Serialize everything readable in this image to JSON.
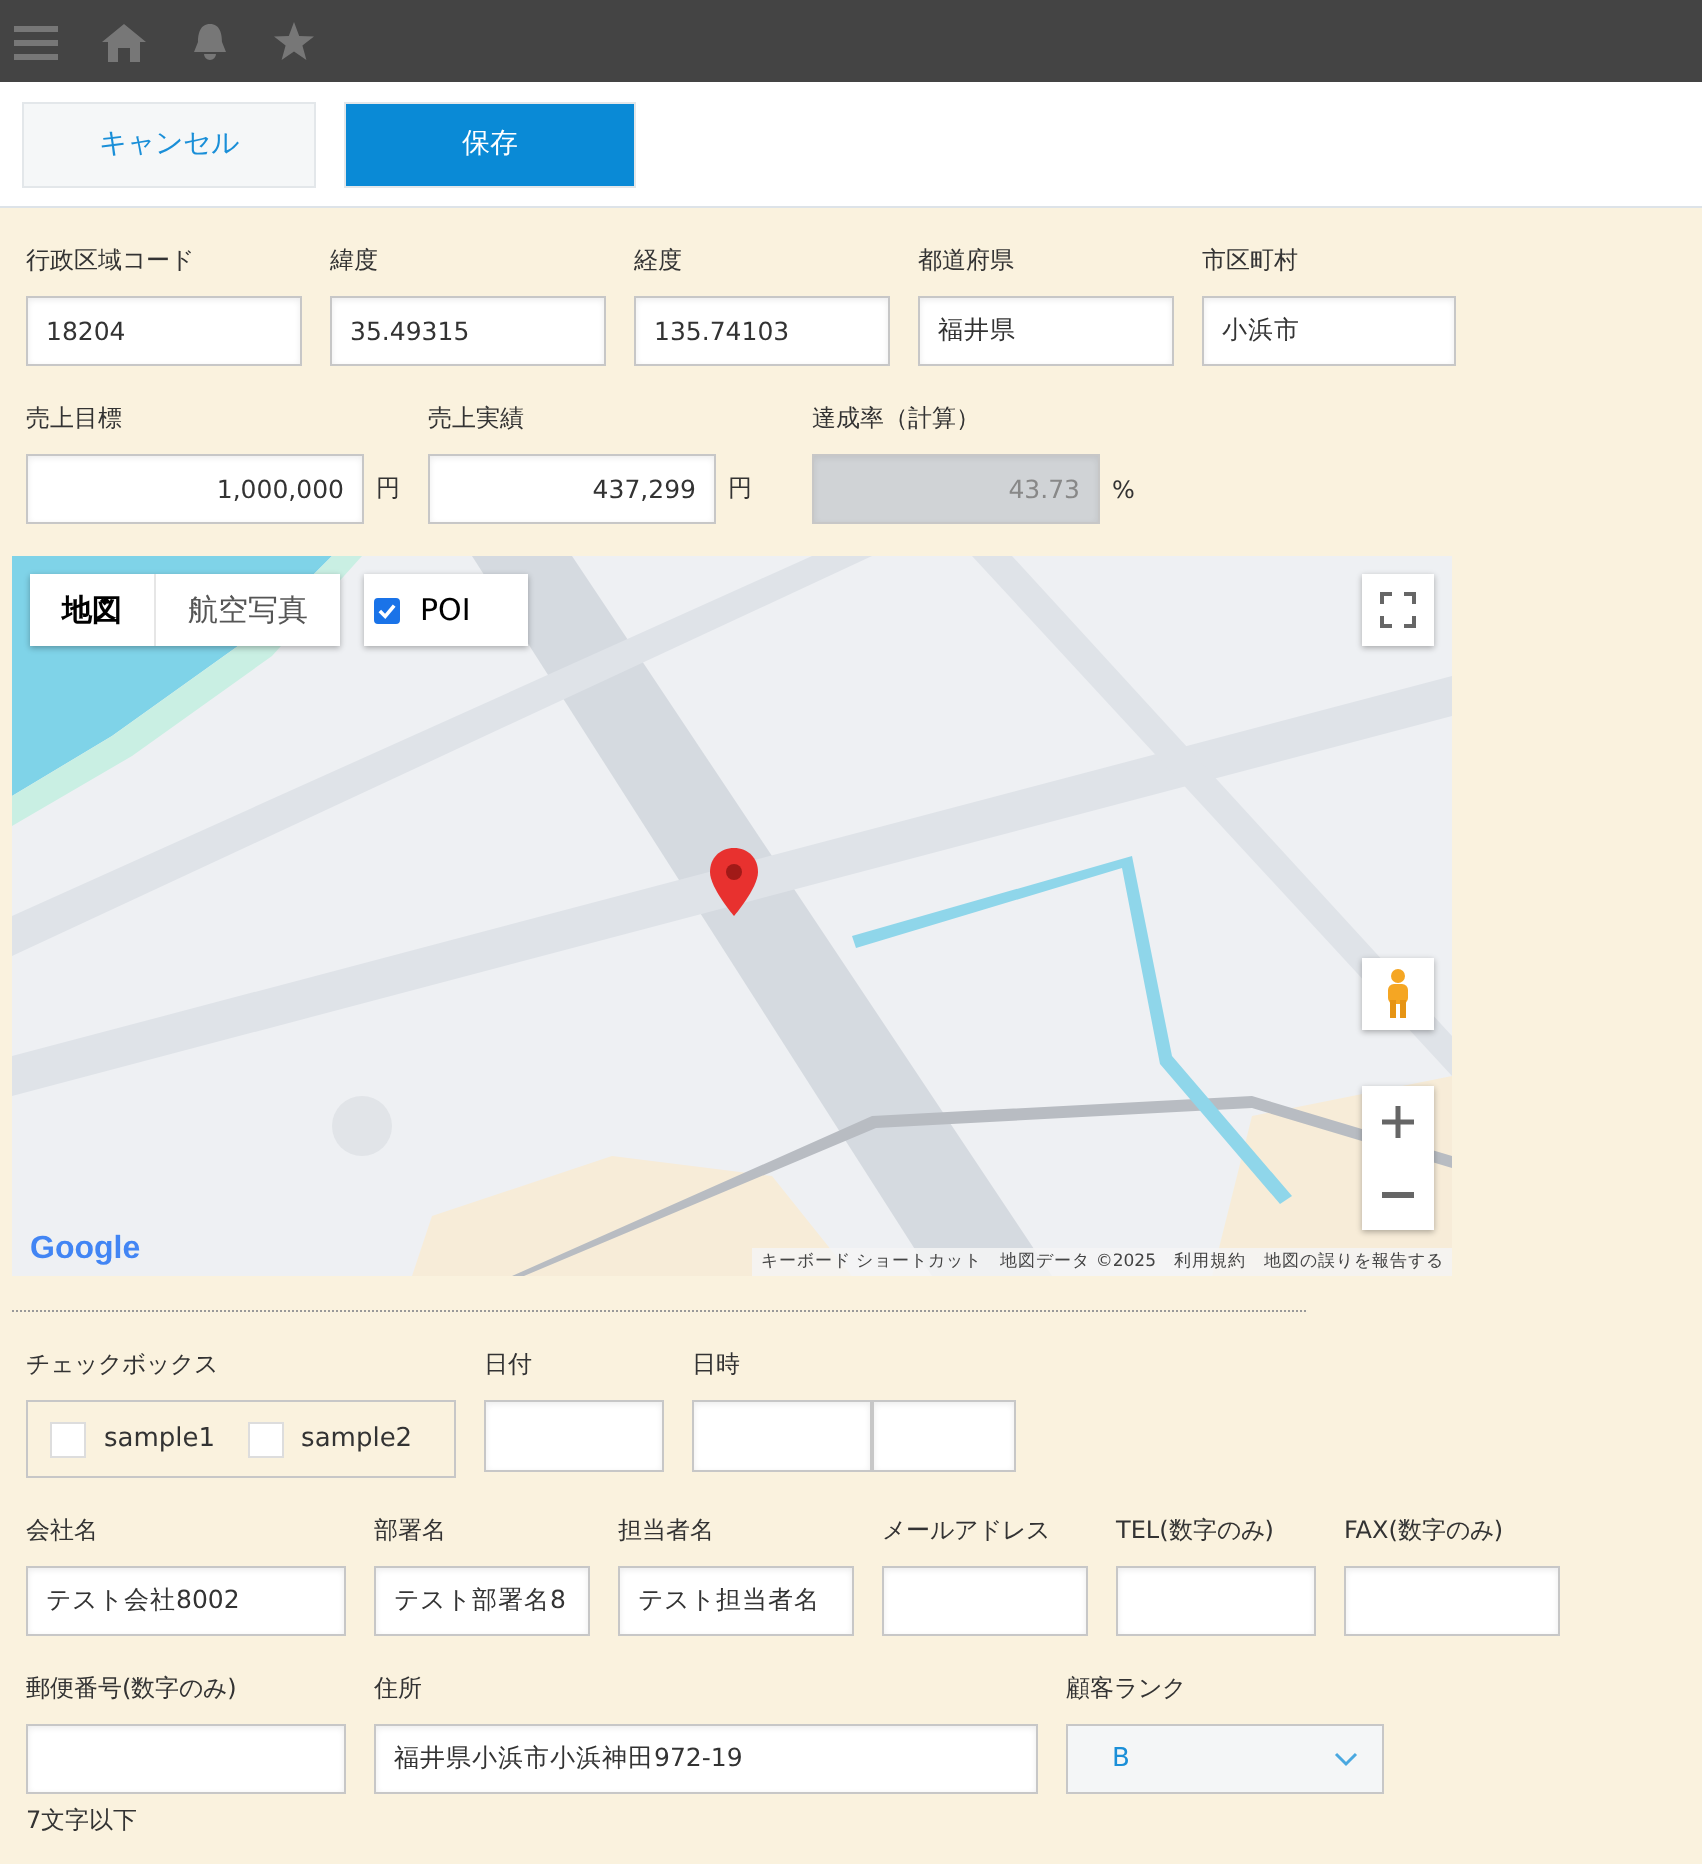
{
  "actions": [
    {
      "label": "キャンセル",
      "kind": "secondary"
    },
    {
      "label": "保存",
      "kind": "primary"
    }
  ],
  "location_fields": [
    {
      "label": "行政区域コード",
      "value": "18204"
    },
    {
      "label": "緯度",
      "value": "35.49315"
    },
    {
      "label": "経度",
      "value": "135.74103"
    },
    {
      "label": "都道府県",
      "value": "福井県"
    },
    {
      "label": "市区町村",
      "value": "小浜市"
    }
  ],
  "sales_fields": [
    {
      "label": "売上目標",
      "value": "1,000,000",
      "unit": "円",
      "disabled": false
    },
    {
      "label": "売上実績",
      "value": "437,299",
      "unit": "円",
      "disabled": false
    },
    {
      "label": "達成率（計算）",
      "value": "43.73",
      "unit": "%",
      "disabled": true
    }
  ],
  "map": {
    "type_tabs": [
      {
        "label": "地図",
        "selected": true
      },
      {
        "label": "航空写真",
        "selected": false
      }
    ],
    "poi": {
      "label": "POI",
      "checked": true
    },
    "logo": "Google",
    "footer": [
      "キーボード ショートカット",
      "地図データ ©2025",
      "利用規約",
      "地図の誤りを報告する"
    ]
  },
  "checkbox_group": {
    "label": "チェックボックス",
    "options": [
      {
        "label": "sample1",
        "checked": false
      },
      {
        "label": "sample2",
        "checked": false
      }
    ]
  },
  "date": {
    "label": "日付"
  },
  "datetime": {
    "label": "日時"
  },
  "contact_fields": [
    {
      "label": "会社名",
      "value": "テスト会社8002"
    },
    {
      "label": "部署名",
      "value": "テスト部署名8"
    },
    {
      "label": "担当者名",
      "value": "テスト担当者名"
    },
    {
      "label": "メールアドレス"
    },
    {
      "label": "TEL(数字のみ)"
    },
    {
      "label": "FAX(数字のみ)"
    }
  ],
  "postal": {
    "label": "郵便番号(数字のみ)",
    "hint": "7文字以下"
  },
  "address": {
    "label": "住所",
    "value": "福井県小浜市小浜神田972-19"
  },
  "rank": {
    "label": "顧客ランク",
    "value": "B"
  }
}
